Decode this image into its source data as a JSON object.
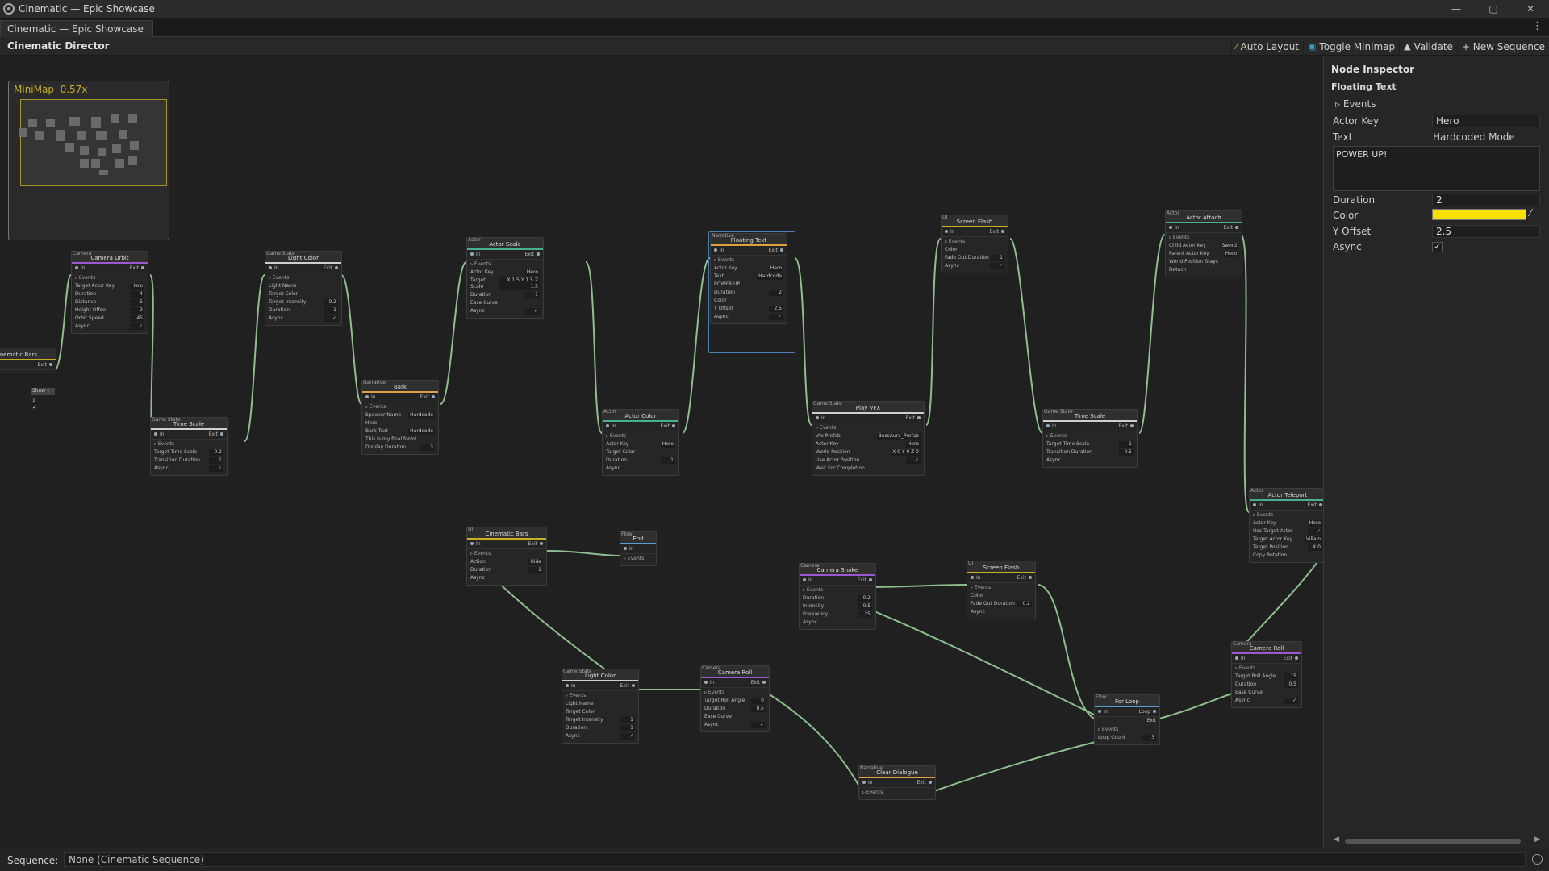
{
  "window": {
    "title": "Cinematic — Epic Showcase",
    "tab": "Cinematic — Epic Showcase",
    "controls": [
      "—",
      "▢",
      "✕"
    ],
    "menu_glyph": "⋮"
  },
  "toolbar": {
    "title": "Cinematic Director",
    "auto_layout": "Auto Layout",
    "toggle_minimap": "Toggle Minimap",
    "validate": "Validate",
    "new_sequence": "+ New Sequence"
  },
  "minimap": {
    "label": "MiniMap",
    "zoom": "0.57x"
  },
  "pins": {
    "in": "In",
    "exit": "Exit",
    "loop": "Loop",
    "events": "▹ Events"
  },
  "nodes": {
    "bars0": {
      "title": "Cinematic Bars",
      "category": "",
      "sel": "Show",
      "dur": "1"
    },
    "orbit": {
      "category": "Camera",
      "title": "Camera Orbit",
      "rows": [
        [
          "Target Actor Key",
          "Hero"
        ],
        [
          "Duration",
          "4"
        ],
        [
          "Distance",
          "5"
        ],
        [
          "Height Offset",
          "2"
        ],
        [
          "Orbit Speed",
          "45"
        ],
        [
          "Async",
          "✓"
        ]
      ]
    },
    "ts1": {
      "category": "Game State",
      "title": "Time Scale",
      "rows": [
        [
          "Target Time Scale",
          "0.2"
        ],
        [
          "Transition Duration",
          "1"
        ],
        [
          "Async",
          "✓"
        ]
      ]
    },
    "light1": {
      "category": "Game State",
      "title": "Light Color",
      "rows": [
        [
          "Light Name",
          ""
        ],
        [
          "Target Color",
          ""
        ],
        [
          "Target Intensity",
          "0.2"
        ],
        [
          "Duration",
          "1"
        ],
        [
          "Async",
          "✓"
        ]
      ]
    },
    "bark": {
      "category": "Narrative",
      "title": "Bark",
      "rows": [
        [
          "Speaker Name",
          "Hardcode"
        ],
        [
          "Hero",
          ""
        ],
        [
          "Bark Text",
          "Hardcode"
        ],
        [
          "This is my final form!",
          ""
        ],
        [
          "Display Duration",
          "3"
        ]
      ]
    },
    "scale": {
      "category": "Actor",
      "title": "Actor Scale",
      "rows": [
        [
          "Actor Key",
          "Hero"
        ],
        [
          "Target Scale",
          "X 1.5 Y 1.5 Z 1.5"
        ],
        [
          "Duration",
          "1"
        ],
        [
          "Ease Curve",
          ""
        ],
        [
          "Async",
          "✓"
        ]
      ]
    },
    "color": {
      "category": "Actor",
      "title": "Actor Color",
      "rows": [
        [
          "Actor Key",
          "Hero"
        ],
        [
          "Target Color",
          ""
        ],
        [
          "Duration",
          "1"
        ],
        [
          "Async",
          ""
        ]
      ]
    },
    "float": {
      "category": "Narrative",
      "title": "Floating Text",
      "rows": [
        [
          "Actor Key",
          "Hero"
        ],
        [
          "Text",
          "Hardcode"
        ],
        [
          "POWER UP!",
          ""
        ],
        [
          "Duration",
          "2"
        ],
        [
          "Color",
          ""
        ],
        [
          "Y Offset",
          "2.5"
        ],
        [
          "Async",
          "✓"
        ]
      ]
    },
    "vfx": {
      "category": "Game State",
      "title": "Play VFX",
      "rows": [
        [
          "Vfx Prefab",
          "BossAura_Prefab"
        ],
        [
          "Actor Key",
          "Hero"
        ],
        [
          "World Position",
          "X 0 Y 0 Z 0"
        ],
        [
          "Use Actor Position",
          "✓"
        ],
        [
          "Wait For Completion",
          ""
        ]
      ]
    },
    "flash1": {
      "category": "UI",
      "title": "Screen Flash",
      "rows": [
        [
          "Color",
          ""
        ],
        [
          "Fade Out Duration",
          "1"
        ],
        [
          "Async",
          "✓"
        ]
      ]
    },
    "ts2": {
      "category": "Game State",
      "title": "Time Scale",
      "rows": [
        [
          "Target Time Scale",
          "1"
        ],
        [
          "Transition Duration",
          "0.5"
        ],
        [
          "Async",
          ""
        ]
      ]
    },
    "attach": {
      "category": "Actor",
      "title": "Actor Attach",
      "rows": [
        [
          "Child Actor Key",
          "Sword"
        ],
        [
          "Parent Actor Key",
          "Hero"
        ],
        [
          "World Position Stays",
          ""
        ],
        [
          "Detach",
          ""
        ]
      ]
    },
    "teleport": {
      "category": "Actor",
      "title": "Actor Teleport",
      "rows": [
        [
          "Actor Key",
          "Hero"
        ],
        [
          "Use Target Actor",
          "✓"
        ],
        [
          "Target Actor Key",
          "Villain"
        ],
        [
          "Target Position",
          "X 0"
        ],
        [
          "Copy Rotation",
          ""
        ]
      ]
    },
    "bars1": {
      "category": "UI",
      "title": "Cinematic Bars",
      "rows": [
        [
          "Action",
          "Hide"
        ],
        [
          "Duration",
          "1"
        ],
        [
          "Async",
          ""
        ]
      ]
    },
    "end": {
      "category": "Flow",
      "title": "End",
      "rows": []
    },
    "shake": {
      "category": "Camera",
      "title": "Camera Shake",
      "rows": [
        [
          "Duration",
          "0.2"
        ],
        [
          "Intensity",
          "0.5"
        ],
        [
          "Frequency",
          "25"
        ],
        [
          "Async",
          ""
        ]
      ]
    },
    "flash2": {
      "category": "UI",
      "title": "Screen Flash",
      "rows": [
        [
          "Color",
          ""
        ],
        [
          "Fade Out Duration",
          "0.2"
        ],
        [
          "Async",
          ""
        ]
      ]
    },
    "light2": {
      "category": "Game State",
      "title": "Light Color",
      "rows": [
        [
          "Light Name",
          ""
        ],
        [
          "Target Color",
          ""
        ],
        [
          "Target Intensity",
          "1"
        ],
        [
          "Duration",
          "1"
        ],
        [
          "Async",
          "✓"
        ]
      ]
    },
    "roll1": {
      "category": "Camera",
      "title": "Camera Roll",
      "rows": [
        [
          "Target Roll Angle",
          "0"
        ],
        [
          "Duration",
          "0.5"
        ],
        [
          "Ease Curve",
          ""
        ],
        [
          "Async",
          "✓"
        ]
      ]
    },
    "forloop": {
      "category": "Flow",
      "title": "For Loop",
      "rows": [
        [
          "Loop Count",
          "3"
        ]
      ]
    },
    "roll2": {
      "category": "Camera",
      "title": "Camera Roll",
      "rows": [
        [
          "Target Roll Angle",
          "15"
        ],
        [
          "Duration",
          "0.5"
        ],
        [
          "Ease Curve",
          ""
        ],
        [
          "Async",
          "✓"
        ]
      ]
    },
    "dialog": {
      "category": "Narrative",
      "title": "Clear Dialogue",
      "rows": []
    }
  },
  "inspector": {
    "title": "Node Inspector",
    "node_name": "Floating Text",
    "events": "▹ Events",
    "actor_key_label": "Actor Key",
    "actor_key_value": "Hero",
    "text_label": "Text",
    "text_mode": "Hardcoded Mode",
    "text_value": "POWER UP!",
    "duration_label": "Duration",
    "duration_value": "2",
    "color_label": "Color",
    "color_value": "#f5e000",
    "y_offset_label": "Y Offset",
    "y_offset_value": "2.5",
    "async_label": "Async",
    "async_value": "✓"
  },
  "status": {
    "sequence_label": "Sequence:",
    "sequence_value": "None (Cinematic Sequence)"
  },
  "colors": {
    "edge": "#8fbf8f",
    "accent_yellow": "#c8b020",
    "selected_border": "#4a7fb0"
  }
}
